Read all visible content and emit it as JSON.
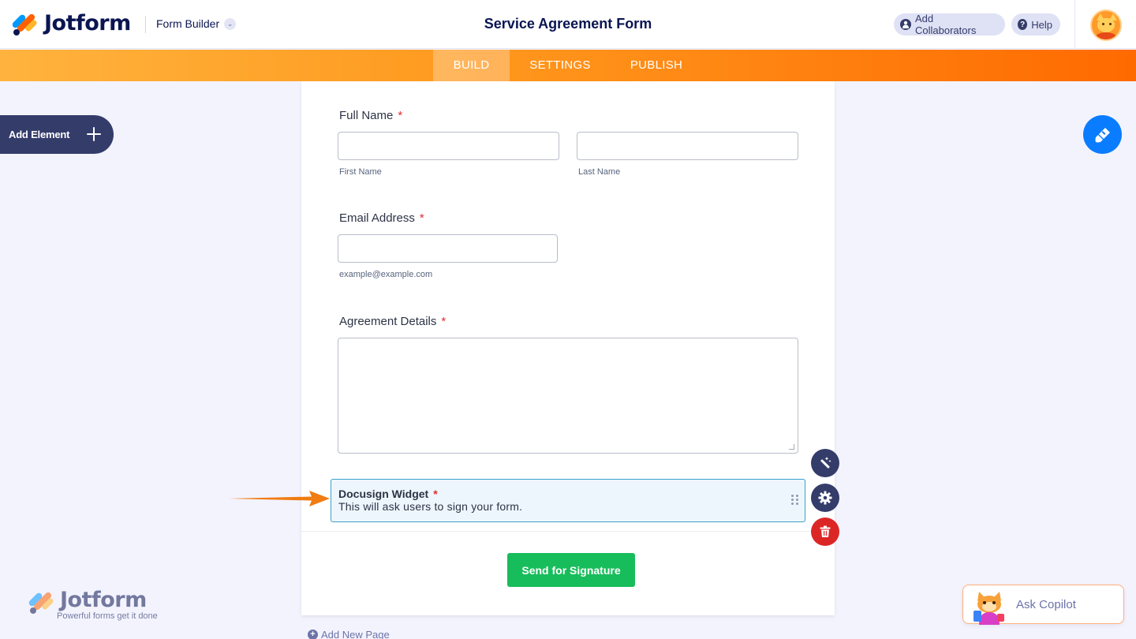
{
  "header": {
    "brand": "Jotform",
    "builder_dropdown": "Form Builder",
    "form_title": "Service Agreement Form",
    "add_collaborators": "Add Collaborators",
    "help": "Help"
  },
  "nav": {
    "tabs": [
      {
        "label": "BUILD",
        "active": true
      },
      {
        "label": "SETTINGS",
        "active": false
      },
      {
        "label": "PUBLISH",
        "active": false
      }
    ]
  },
  "sidebar": {
    "add_element": "Add Element"
  },
  "form": {
    "fields": {
      "full_name": {
        "label": "Full Name",
        "required": "*",
        "first_sublabel": "First Name",
        "last_sublabel": "Last Name",
        "first_value": "",
        "last_value": ""
      },
      "email": {
        "label": "Email Address",
        "required": "*",
        "sublabel": "example@example.com",
        "value": ""
      },
      "agreement": {
        "label": "Agreement Details",
        "required": "*",
        "value": ""
      },
      "docusign": {
        "title": "Docusign Widget",
        "required": "*",
        "description": "This will ask users to sign your form."
      }
    },
    "submit_label": "Send for Signature",
    "add_new_page": "Add New Page"
  },
  "branding": {
    "name": "Jotform",
    "tagline": "Powerful forms get it done"
  },
  "copilot": {
    "label": "Ask Copilot"
  },
  "colors": {
    "accent_orange": "#ff6100",
    "submit_green": "#18bd5b",
    "designer_blue": "#0a7cff",
    "delete_red": "#dc2626",
    "navy": "#0a1551"
  },
  "icons": [
    "logo-icon",
    "chevron-down-icon",
    "user-icon",
    "help-icon",
    "plus-icon",
    "paint-brush-icon",
    "magic-wand-icon",
    "gear-icon",
    "trash-icon",
    "drag-handle-icon",
    "arrow-icon",
    "add-page-icon"
  ]
}
